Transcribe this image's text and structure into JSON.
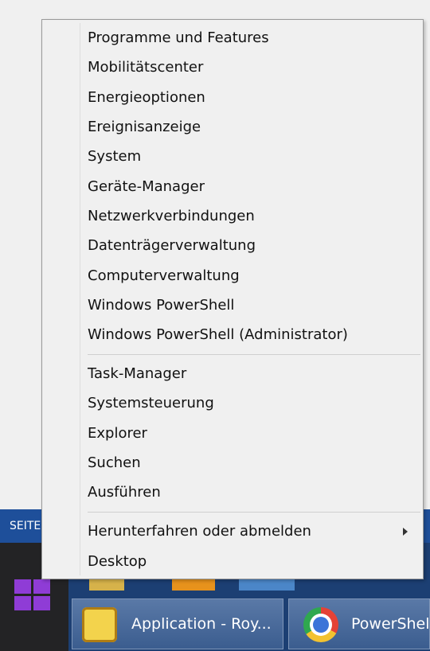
{
  "context_menu": {
    "groups": [
      [
        "Programme und Features",
        "Mobilitätscenter",
        "Energieoptionen",
        "Ereignisanzeige",
        "System",
        "Geräte-Manager",
        "Netzwerkverbindungen",
        "Datenträgerverwaltung",
        "Computerverwaltung",
        "Windows PowerShell",
        "Windows PowerShell (Administrator)"
      ],
      [
        "Task-Manager",
        "Systemsteuerung",
        "Explorer",
        "Suchen",
        "Ausführen"
      ],
      [
        "Herunterfahren oder abmelden",
        "Desktop"
      ]
    ]
  },
  "background": {
    "strip_text": "SEITE"
  },
  "taskbar": {
    "buttons": [
      {
        "label": "Application - Roy...",
        "icon": "app-crown-icon"
      },
      {
        "label": "PowerShell",
        "icon": "chrome-icon"
      }
    ],
    "start_icon": "windows-logo-icon"
  },
  "colors": {
    "menu_bg": "#f0f0f0",
    "taskbar_blue": "#1c3f73",
    "start_purple": "#8f3cd6"
  }
}
